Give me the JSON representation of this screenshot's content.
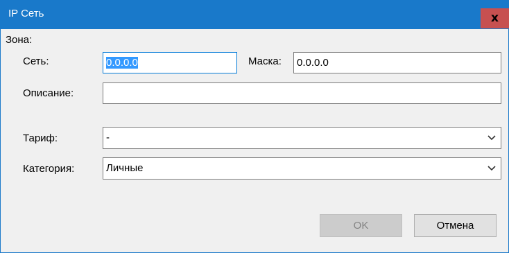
{
  "window": {
    "title": "IP Сеть",
    "close_glyph": "x"
  },
  "form": {
    "zone_label": "Зона:",
    "network_label": "Сеть:",
    "network_value": "0.0.0.0",
    "mask_label": "Маска:",
    "mask_value": "0.0.0.0",
    "description_label": "Описание:",
    "description_value": "",
    "tariff_label": "Тариф:",
    "tariff_value": "-",
    "category_label": "Категория:",
    "category_value": "Личные"
  },
  "buttons": {
    "ok_label": "OK",
    "ok_enabled": false,
    "cancel_label": "Отмена"
  },
  "colors": {
    "titlebar": "#1979ca",
    "close_button": "#c75050",
    "selection": "#3399ff",
    "dialog_background": "#f0f0f0"
  }
}
